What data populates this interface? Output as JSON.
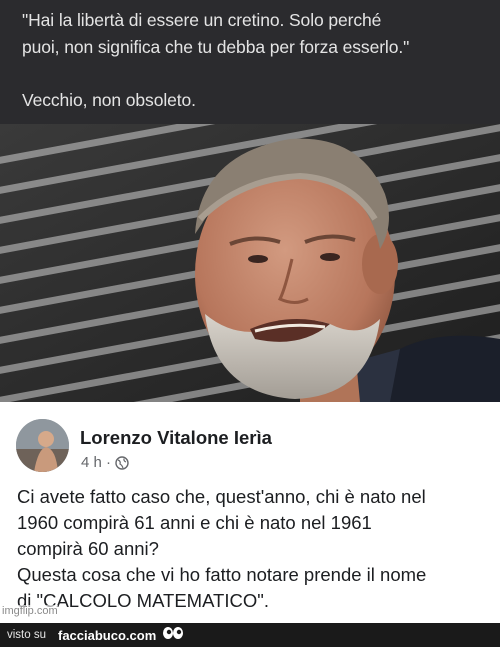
{
  "quote": {
    "line1": "\"Hai la libertà di essere un cretino. Solo perché",
    "line2": "puoi, non significa che tu debba per forza esserlo.\"",
    "line3": "Vecchio, non obsoleto."
  },
  "post": {
    "author": "Lorenzo Vitalone Ierìa",
    "time": "4 h ·",
    "text_lines": [
      "Ci avete fatto caso che, quest'anno, chi è nato nel",
      "1960  compirà 61 anni e chi è nato nel 1961",
      "compirà 60 anni?",
      "Questa cosa che vi ho fatto notare prende il nome",
      "di \"CALCOLO MATEMATICO\"."
    ]
  },
  "watermark": {
    "imgflip": "imgflip.com"
  },
  "footer": {
    "visto_su": "visto su",
    "site": "facciabuco.com"
  },
  "colors": {
    "quote_bg": "#2b2b2e",
    "footer_bg": "#1a1a1a",
    "text_dark": "#1c1e21",
    "meta_gray": "#65676b"
  },
  "icons": [
    "globe-icon",
    "facciabuco-eyes-icon"
  ]
}
